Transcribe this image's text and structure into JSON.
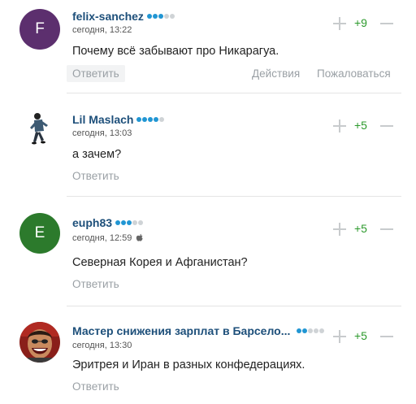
{
  "ui": {
    "reply_label": "Ответить",
    "actions_label": "Действия",
    "complain_label": "Пожаловаться"
  },
  "colors": {
    "author": "#1d4f7a",
    "score_positive": "#2c9a2c",
    "level_dot_on": "#2196d3",
    "level_dot_off": "#cfd3d6"
  },
  "comments": [
    {
      "author": "felix-sanchez",
      "avatar_letter": "F",
      "avatar_color": "#5c2f6e",
      "level": 3,
      "level_max": 5,
      "date": "сегодня, 13:22",
      "text": "Почему всё забывают про Никарагуа.",
      "score": "+9"
    },
    {
      "author": "Lil Maslach",
      "avatar_letter": "",
      "avatar_icon": "dancing-figure-avatar",
      "level": 4,
      "level_max": 5,
      "date": "сегодня, 13:03",
      "text": "а зачем?",
      "score": "+5"
    },
    {
      "author": "euph83",
      "avatar_letter": "E",
      "avatar_color": "#2c7a2c",
      "level": 3,
      "level_max": 5,
      "date": "сегодня, 12:59",
      "device_icon": "apple-icon",
      "text": "Северная Корея и Афганистан?",
      "score": "+5"
    },
    {
      "author": "Мастер снижения зарплат в Барсело...",
      "avatar_letter": "",
      "avatar_icon": "smiling-man-avatar",
      "level": 2,
      "level_max": 5,
      "date": "сегодня, 13:30",
      "text": "Эритрея и Иран в разных конфедерациях.",
      "score": "+5"
    }
  ]
}
